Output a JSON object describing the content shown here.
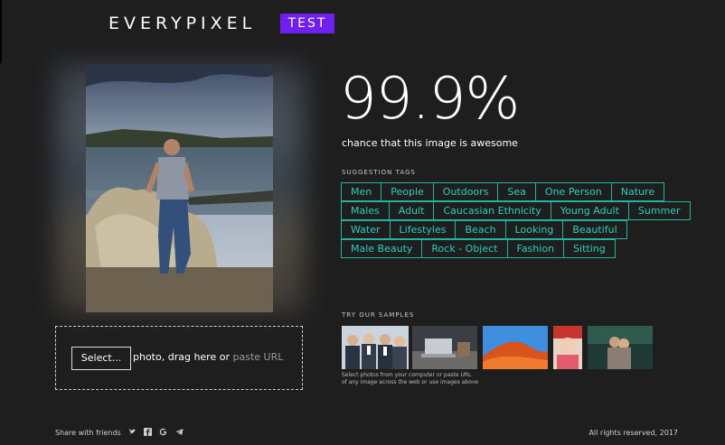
{
  "header": {
    "logo_text": "EVERYPIXEL",
    "badge": "TEST"
  },
  "result": {
    "score": "99.9%",
    "caption": "chance that this image is awesome",
    "tags_title": "SUGGESTION TAGS",
    "tags": [
      [
        "Men",
        "People",
        "Outdoors",
        "Sea",
        "One Person",
        "Nature"
      ],
      [
        "Males",
        "Adult",
        "Caucasian Ethnicity",
        "Young Adult",
        "Summer"
      ],
      [
        "Water",
        "Lifestyles",
        "Beach",
        "Looking",
        "Beautiful"
      ],
      [
        "Male Beauty",
        "Rock - Object",
        "Fashion",
        "Sitting"
      ]
    ]
  },
  "upload": {
    "select_label": "Select...",
    "text_main": "photo, drag here or",
    "text_muted": "paste URL"
  },
  "samples": {
    "title": "TRY OUR SAMPLES",
    "note_line1": "Select photos from your computer or paste URL",
    "note_line2": "of any image across the web or use images above",
    "items": [
      "business-people",
      "laptop-desk",
      "red-dunes",
      "girl-portrait",
      "couple-forest"
    ]
  },
  "footer": {
    "share_label": "Share with friends",
    "social_icons": [
      "twitter-icon",
      "facebook-icon",
      "google-icon",
      "telegram-icon"
    ],
    "copyright": "All rights reserved, 2017"
  },
  "colors": {
    "accent": "#6f1ff2",
    "tag": "#29d1bb",
    "background": "#1e1e1f"
  }
}
